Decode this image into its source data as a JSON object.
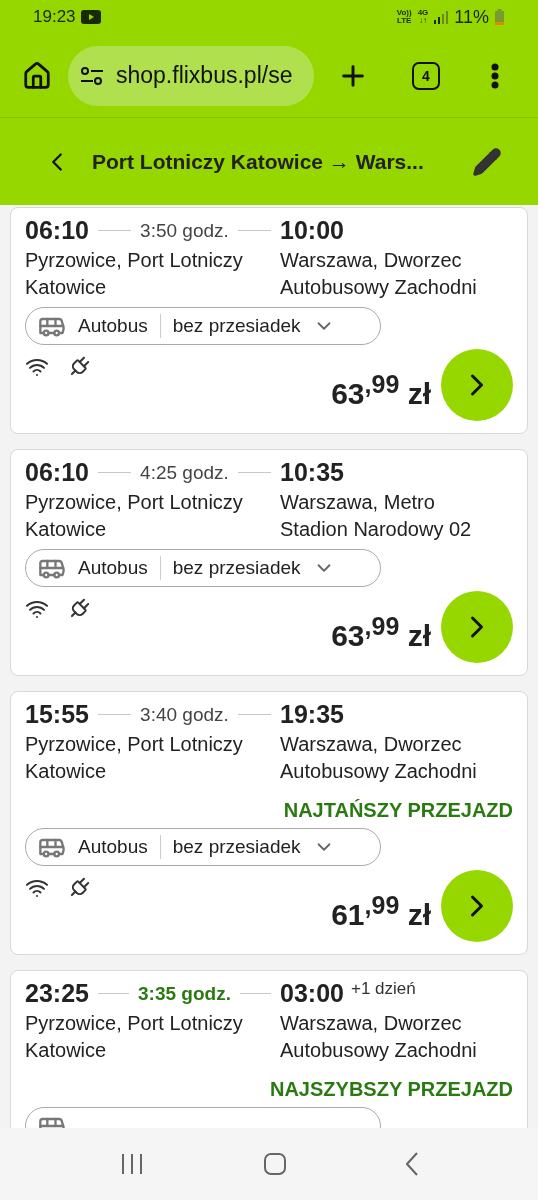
{
  "status_bar": {
    "time": "19:23",
    "volte": "Vo))",
    "lte": "LTE",
    "network": "4G",
    "data_arrows": "↓↑",
    "battery": "11%"
  },
  "browser": {
    "url": "shop.flixbus.pl/se",
    "tab_count": "4"
  },
  "route_bar": {
    "title": "Port Lotniczy Katowice → Wars..."
  },
  "trips": [
    {
      "departure": "06:10",
      "duration": "3:50 godz.",
      "duration_highlight": false,
      "arrival": "10:00",
      "from": "Pyrzowice, Port Lotniczy Katowice",
      "to": "Warszawa, Dworzec Autobusowy Zachodni",
      "mode": "Autobus",
      "changes": "bez przesiadek",
      "price_main": "63",
      "price_decimals": ",99",
      "currency": "zł"
    },
    {
      "departure": "06:10",
      "duration": "4:25 godz.",
      "duration_highlight": false,
      "arrival": "10:35",
      "from": "Pyrzowice, Port Lotniczy Katowice",
      "to": "Warszawa, Metro Stadion Narodowy 02",
      "mode": "Autobus",
      "changes": "bez przesiadek",
      "price_main": "63",
      "price_decimals": ",99",
      "currency": "zł"
    },
    {
      "departure": "15:55",
      "duration": "3:40 godz.",
      "duration_highlight": false,
      "arrival": "19:35",
      "from": "Pyrzowice, Port Lotniczy Katowice",
      "to": "Warszawa, Dworzec Autobusowy Zachodni",
      "badge": "NAJTAŃSZY PRZEJAZD",
      "mode": "Autobus",
      "changes": "bez przesiadek",
      "price_main": "61",
      "price_decimals": ",99",
      "currency": "zł"
    },
    {
      "departure": "23:25",
      "duration": "3:35 godz.",
      "duration_highlight": true,
      "arrival": "03:00",
      "arrival_note": "+1 dzień",
      "from": "Pyrzowice, Port Lotniczy Katowice",
      "to": "Warszawa, Dworzec Autobusowy Zachodni",
      "badge": "NAJSZYBSZY PRZEJAZD"
    }
  ]
}
